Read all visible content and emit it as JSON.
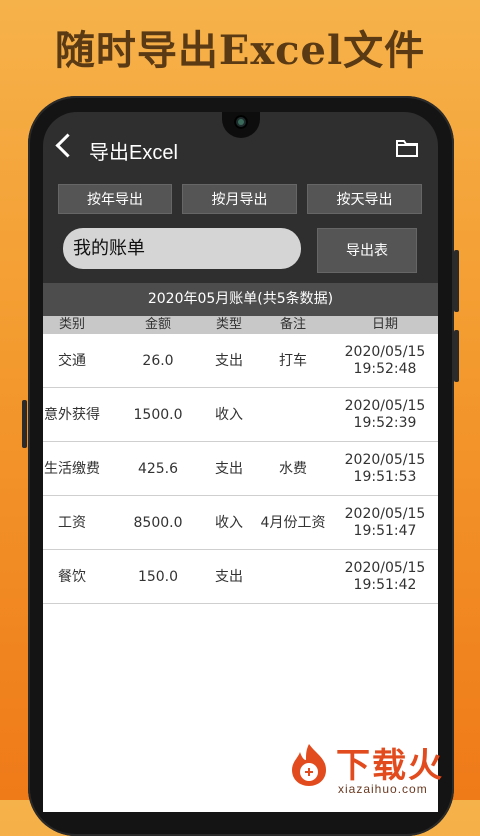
{
  "promo": {
    "title": "随时导出Excel文件"
  },
  "appbar": {
    "title": "导出Excel"
  },
  "buttons": {
    "by_year": "按年导出",
    "by_month": "按月导出",
    "by_day": "按天导出",
    "export": "导出表"
  },
  "input": {
    "value": "我的账单"
  },
  "sheet": {
    "header": "2020年05月账单(共5条数据)"
  },
  "table": {
    "columns": [
      "类别",
      "金额",
      "类型",
      "备注",
      "日期"
    ],
    "rows": [
      {
        "category": "交通",
        "amount": "26.0",
        "type": "支出",
        "note": "打车",
        "date": "2020/05/15",
        "time": "19:52:48"
      },
      {
        "category": "意外获得",
        "amount": "1500.0",
        "type": "收入",
        "note": "",
        "date": "2020/05/15",
        "time": "19:52:39"
      },
      {
        "category": "生活缴费",
        "amount": "425.6",
        "type": "支出",
        "note": "水费",
        "date": "2020/05/15",
        "time": "19:51:53"
      },
      {
        "category": "工资",
        "amount": "8500.0",
        "type": "收入",
        "note": "4月份工资",
        "date": "2020/05/15",
        "time": "19:51:47"
      },
      {
        "category": "餐饮",
        "amount": "150.0",
        "type": "支出",
        "note": "",
        "date": "2020/05/15",
        "time": "19:51:42"
      }
    ]
  },
  "watermark": {
    "brand": "下载火",
    "url": "xiazaihuo.com"
  },
  "icons": {
    "back": "back-arrow-icon",
    "folder": "folder-icon"
  },
  "colors": {
    "accent_orange": "#f39a2e",
    "dark_bg": "#2f2f2f",
    "brand_red": "#e24b1d"
  }
}
